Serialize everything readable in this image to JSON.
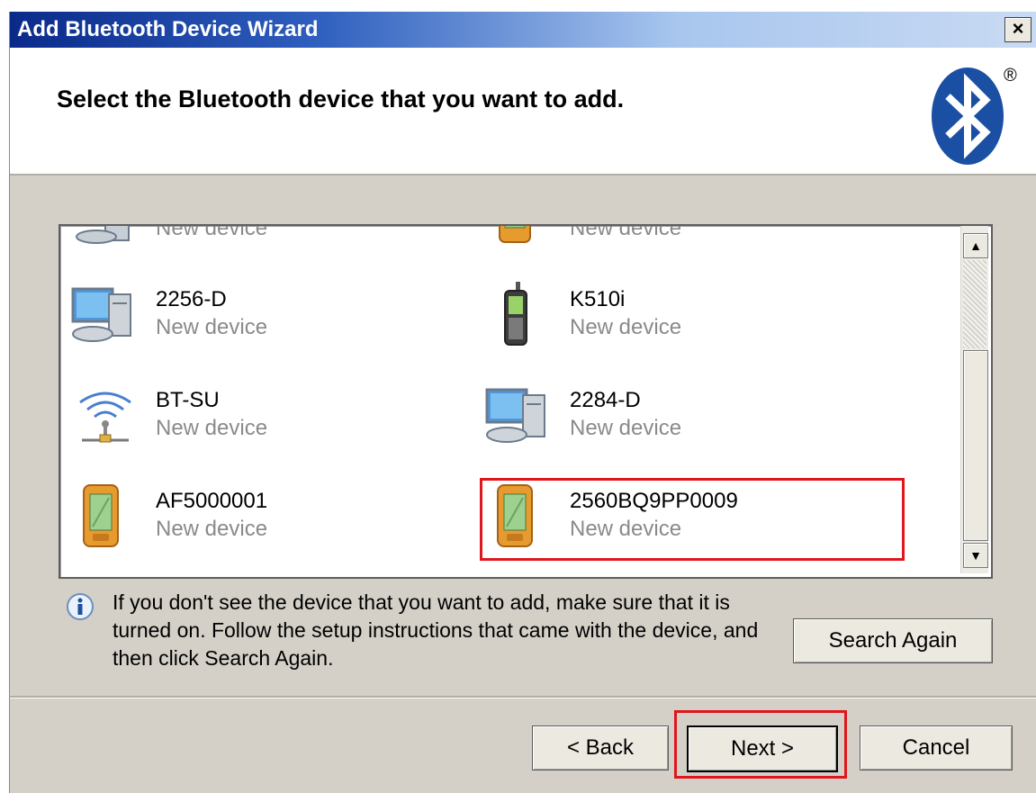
{
  "window": {
    "title": "Add Bluetooth Device Wizard",
    "close_label": "×"
  },
  "header": {
    "title": "Select the Bluetooth device that you want to add.",
    "registered_mark": "®"
  },
  "devices": [
    {
      "name": "",
      "status": "New device",
      "icon": "computer-icon"
    },
    {
      "name": "",
      "status": "New device",
      "icon": "pda-icon"
    },
    {
      "name": "2256-D",
      "status": "New device",
      "icon": "computer-icon"
    },
    {
      "name": "K510i",
      "status": "New device",
      "icon": "phone-icon"
    },
    {
      "name": "BT-SU",
      "status": "New device",
      "icon": "wireless-access-point-icon"
    },
    {
      "name": "2284-D",
      "status": "New device",
      "icon": "computer-icon"
    },
    {
      "name": "AF5000001",
      "status": "New device",
      "icon": "pda-icon"
    },
    {
      "name": "2560BQ9PP0009",
      "status": "New device",
      "icon": "pda-icon",
      "highlighted": true
    }
  ],
  "info": {
    "text": "If you don't see the device that you want to add, make sure that it is turned on. Follow the setup instructions that came with the device, and then click Search Again."
  },
  "buttons": {
    "search_again": "Search Again",
    "back": "< Back",
    "next": "Next >",
    "cancel": "Cancel"
  },
  "colors": {
    "highlight": "#e0161c",
    "bluetooth": "#1a4fa3"
  }
}
